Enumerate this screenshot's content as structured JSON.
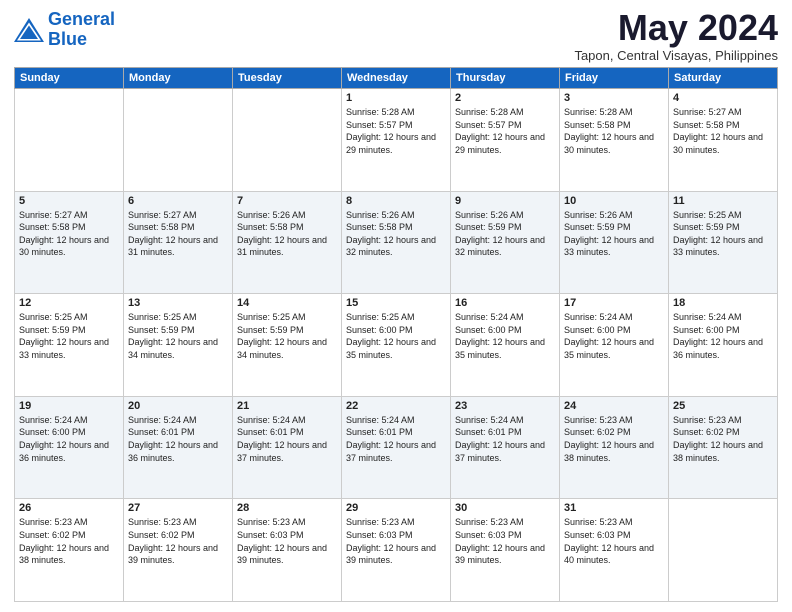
{
  "logo": {
    "line1": "General",
    "line2": "Blue"
  },
  "title": "May 2024",
  "subtitle": "Tapon, Central Visayas, Philippines",
  "days_of_week": [
    "Sunday",
    "Monday",
    "Tuesday",
    "Wednesday",
    "Thursday",
    "Friday",
    "Saturday"
  ],
  "weeks": [
    [
      {
        "day": "",
        "sunrise": "",
        "sunset": "",
        "daylight": ""
      },
      {
        "day": "",
        "sunrise": "",
        "sunset": "",
        "daylight": ""
      },
      {
        "day": "",
        "sunrise": "",
        "sunset": "",
        "daylight": ""
      },
      {
        "day": "1",
        "sunrise": "Sunrise: 5:28 AM",
        "sunset": "Sunset: 5:57 PM",
        "daylight": "Daylight: 12 hours and 29 minutes."
      },
      {
        "day": "2",
        "sunrise": "Sunrise: 5:28 AM",
        "sunset": "Sunset: 5:57 PM",
        "daylight": "Daylight: 12 hours and 29 minutes."
      },
      {
        "day": "3",
        "sunrise": "Sunrise: 5:28 AM",
        "sunset": "Sunset: 5:58 PM",
        "daylight": "Daylight: 12 hours and 30 minutes."
      },
      {
        "day": "4",
        "sunrise": "Sunrise: 5:27 AM",
        "sunset": "Sunset: 5:58 PM",
        "daylight": "Daylight: 12 hours and 30 minutes."
      }
    ],
    [
      {
        "day": "5",
        "sunrise": "Sunrise: 5:27 AM",
        "sunset": "Sunset: 5:58 PM",
        "daylight": "Daylight: 12 hours and 30 minutes."
      },
      {
        "day": "6",
        "sunrise": "Sunrise: 5:27 AM",
        "sunset": "Sunset: 5:58 PM",
        "daylight": "Daylight: 12 hours and 31 minutes."
      },
      {
        "day": "7",
        "sunrise": "Sunrise: 5:26 AM",
        "sunset": "Sunset: 5:58 PM",
        "daylight": "Daylight: 12 hours and 31 minutes."
      },
      {
        "day": "8",
        "sunrise": "Sunrise: 5:26 AM",
        "sunset": "Sunset: 5:58 PM",
        "daylight": "Daylight: 12 hours and 32 minutes."
      },
      {
        "day": "9",
        "sunrise": "Sunrise: 5:26 AM",
        "sunset": "Sunset: 5:59 PM",
        "daylight": "Daylight: 12 hours and 32 minutes."
      },
      {
        "day": "10",
        "sunrise": "Sunrise: 5:26 AM",
        "sunset": "Sunset: 5:59 PM",
        "daylight": "Daylight: 12 hours and 33 minutes."
      },
      {
        "day": "11",
        "sunrise": "Sunrise: 5:25 AM",
        "sunset": "Sunset: 5:59 PM",
        "daylight": "Daylight: 12 hours and 33 minutes."
      }
    ],
    [
      {
        "day": "12",
        "sunrise": "Sunrise: 5:25 AM",
        "sunset": "Sunset: 5:59 PM",
        "daylight": "Daylight: 12 hours and 33 minutes."
      },
      {
        "day": "13",
        "sunrise": "Sunrise: 5:25 AM",
        "sunset": "Sunset: 5:59 PM",
        "daylight": "Daylight: 12 hours and 34 minutes."
      },
      {
        "day": "14",
        "sunrise": "Sunrise: 5:25 AM",
        "sunset": "Sunset: 5:59 PM",
        "daylight": "Daylight: 12 hours and 34 minutes."
      },
      {
        "day": "15",
        "sunrise": "Sunrise: 5:25 AM",
        "sunset": "Sunset: 6:00 PM",
        "daylight": "Daylight: 12 hours and 35 minutes."
      },
      {
        "day": "16",
        "sunrise": "Sunrise: 5:24 AM",
        "sunset": "Sunset: 6:00 PM",
        "daylight": "Daylight: 12 hours and 35 minutes."
      },
      {
        "day": "17",
        "sunrise": "Sunrise: 5:24 AM",
        "sunset": "Sunset: 6:00 PM",
        "daylight": "Daylight: 12 hours and 35 minutes."
      },
      {
        "day": "18",
        "sunrise": "Sunrise: 5:24 AM",
        "sunset": "Sunset: 6:00 PM",
        "daylight": "Daylight: 12 hours and 36 minutes."
      }
    ],
    [
      {
        "day": "19",
        "sunrise": "Sunrise: 5:24 AM",
        "sunset": "Sunset: 6:00 PM",
        "daylight": "Daylight: 12 hours and 36 minutes."
      },
      {
        "day": "20",
        "sunrise": "Sunrise: 5:24 AM",
        "sunset": "Sunset: 6:01 PM",
        "daylight": "Daylight: 12 hours and 36 minutes."
      },
      {
        "day": "21",
        "sunrise": "Sunrise: 5:24 AM",
        "sunset": "Sunset: 6:01 PM",
        "daylight": "Daylight: 12 hours and 37 minutes."
      },
      {
        "day": "22",
        "sunrise": "Sunrise: 5:24 AM",
        "sunset": "Sunset: 6:01 PM",
        "daylight": "Daylight: 12 hours and 37 minutes."
      },
      {
        "day": "23",
        "sunrise": "Sunrise: 5:24 AM",
        "sunset": "Sunset: 6:01 PM",
        "daylight": "Daylight: 12 hours and 37 minutes."
      },
      {
        "day": "24",
        "sunrise": "Sunrise: 5:23 AM",
        "sunset": "Sunset: 6:02 PM",
        "daylight": "Daylight: 12 hours and 38 minutes."
      },
      {
        "day": "25",
        "sunrise": "Sunrise: 5:23 AM",
        "sunset": "Sunset: 6:02 PM",
        "daylight": "Daylight: 12 hours and 38 minutes."
      }
    ],
    [
      {
        "day": "26",
        "sunrise": "Sunrise: 5:23 AM",
        "sunset": "Sunset: 6:02 PM",
        "daylight": "Daylight: 12 hours and 38 minutes."
      },
      {
        "day": "27",
        "sunrise": "Sunrise: 5:23 AM",
        "sunset": "Sunset: 6:02 PM",
        "daylight": "Daylight: 12 hours and 39 minutes."
      },
      {
        "day": "28",
        "sunrise": "Sunrise: 5:23 AM",
        "sunset": "Sunset: 6:03 PM",
        "daylight": "Daylight: 12 hours and 39 minutes."
      },
      {
        "day": "29",
        "sunrise": "Sunrise: 5:23 AM",
        "sunset": "Sunset: 6:03 PM",
        "daylight": "Daylight: 12 hours and 39 minutes."
      },
      {
        "day": "30",
        "sunrise": "Sunrise: 5:23 AM",
        "sunset": "Sunset: 6:03 PM",
        "daylight": "Daylight: 12 hours and 39 minutes."
      },
      {
        "day": "31",
        "sunrise": "Sunrise: 5:23 AM",
        "sunset": "Sunset: 6:03 PM",
        "daylight": "Daylight: 12 hours and 40 minutes."
      },
      {
        "day": "",
        "sunrise": "",
        "sunset": "",
        "daylight": ""
      }
    ]
  ]
}
